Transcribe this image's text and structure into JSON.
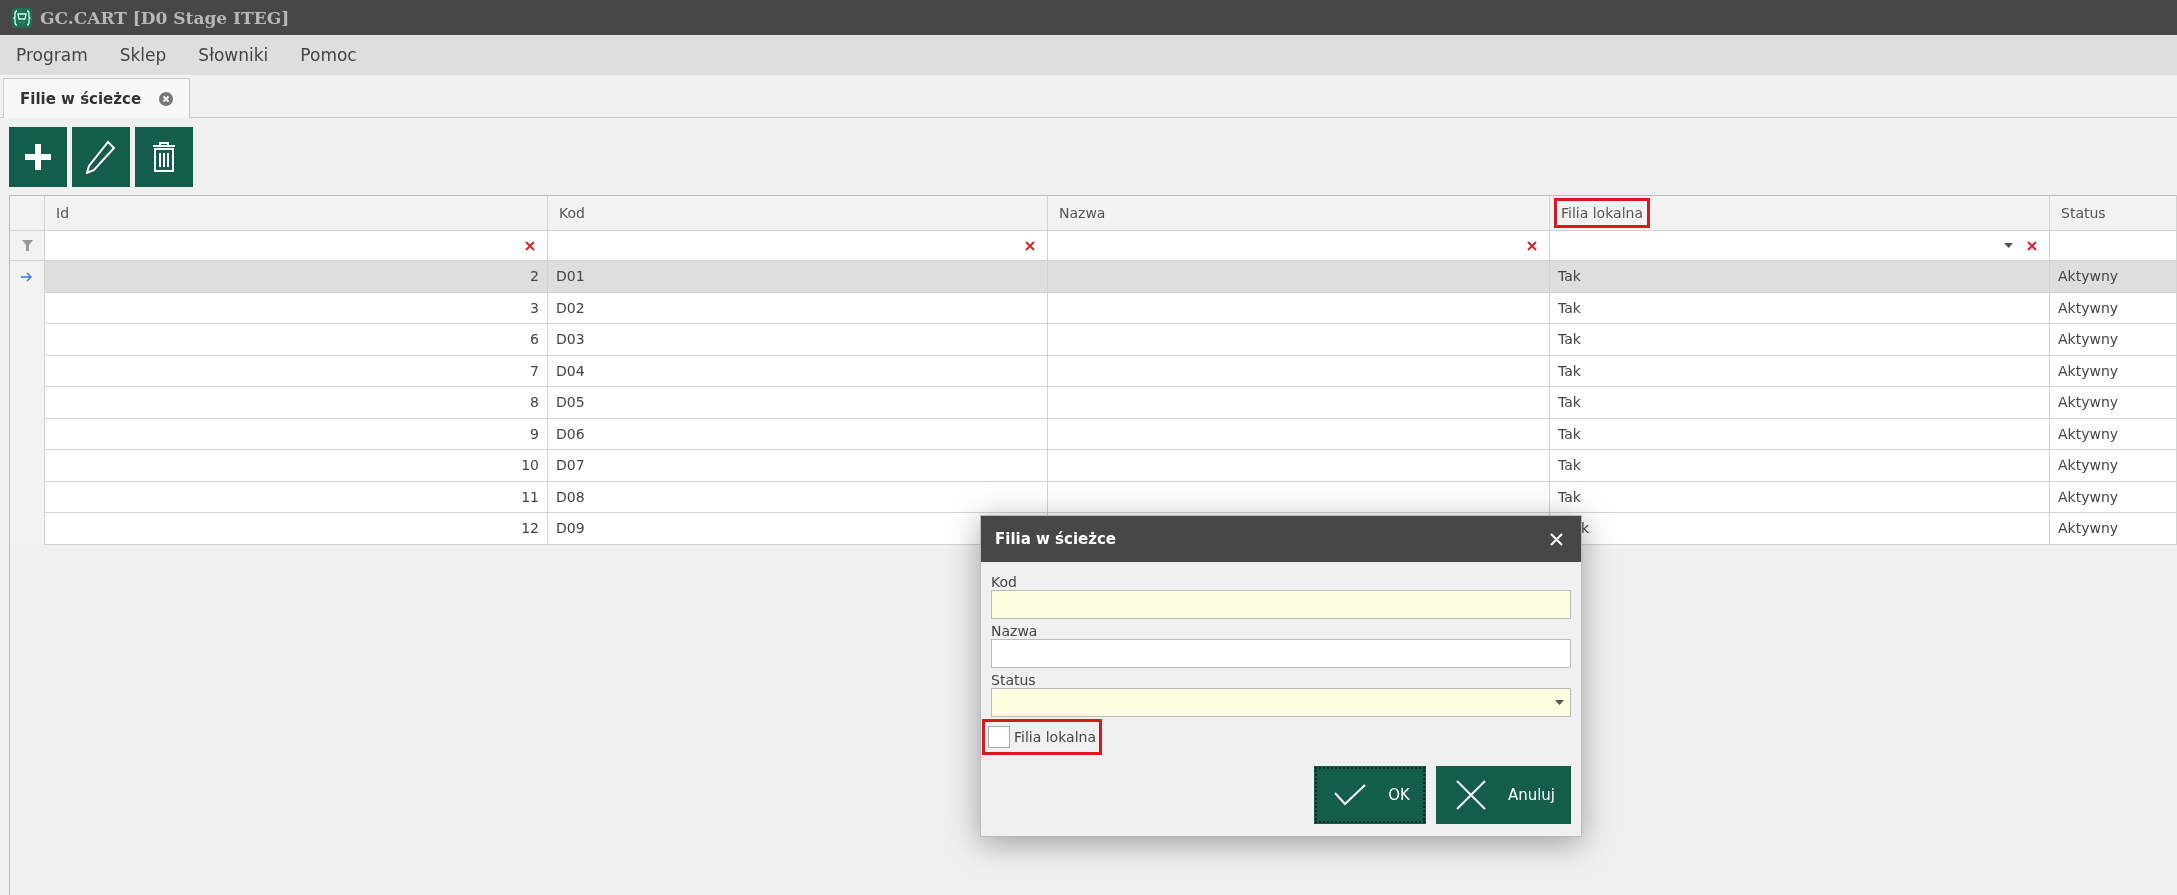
{
  "window": {
    "title": "GC.CART [D0 Stage ITEG]"
  },
  "menu": [
    "Program",
    "Sklep",
    "Słowniki",
    "Pomoc"
  ],
  "tabs": [
    {
      "label": "Filie w ścieżce",
      "selected": true
    }
  ],
  "toolbar": [
    {
      "kind": "add"
    },
    {
      "kind": "edit"
    },
    {
      "kind": "delete"
    }
  ],
  "grid": {
    "columns": [
      {
        "label": "Id",
        "highlighted": false,
        "filter_clear": true,
        "filter_dropdown": false
      },
      {
        "label": "Kod",
        "highlighted": false,
        "filter_clear": true,
        "filter_dropdown": false
      },
      {
        "label": "Nazwa",
        "highlighted": false,
        "filter_clear": true,
        "filter_dropdown": false
      },
      {
        "label": "Filia lokalna",
        "highlighted": true,
        "filter_clear": true,
        "filter_dropdown": true
      },
      {
        "label": "Status",
        "highlighted": false,
        "filter_clear": false,
        "filter_dropdown": false
      }
    ],
    "rows": [
      {
        "selected": true,
        "id": "2",
        "kod": "D01",
        "filia": "Tak",
        "status": "Aktywny"
      },
      {
        "selected": false,
        "id": "3",
        "kod": "D02",
        "filia": "Tak",
        "status": "Aktywny"
      },
      {
        "selected": false,
        "id": "6",
        "kod": "D03",
        "filia": "Tak",
        "status": "Aktywny"
      },
      {
        "selected": false,
        "id": "7",
        "kod": "D04",
        "filia": "Tak",
        "status": "Aktywny"
      },
      {
        "selected": false,
        "id": "8",
        "kod": "D05",
        "filia": "Tak",
        "status": "Aktywny"
      },
      {
        "selected": false,
        "id": "9",
        "kod": "D06",
        "filia": "Tak",
        "status": "Aktywny"
      },
      {
        "selected": false,
        "id": "10",
        "kod": "D07",
        "filia": "Tak",
        "status": "Aktywny"
      },
      {
        "selected": false,
        "id": "11",
        "kod": "D08",
        "filia": "Tak",
        "status": "Aktywny"
      },
      {
        "selected": false,
        "id": "12",
        "kod": "D09",
        "filia": "k",
        "status": "Aktywny",
        "covered": true
      }
    ]
  },
  "dialog": {
    "title": "Filia w ścieżce",
    "fields": [
      {
        "label": "Kod",
        "kind": "text",
        "required": true
      },
      {
        "label": "Nazwa",
        "kind": "text",
        "required": false
      },
      {
        "label": "Status",
        "kind": "dropdown",
        "required": true
      }
    ],
    "checkbox": {
      "label": "Filia lokalna",
      "checked": false,
      "highlighted": true
    },
    "buttons": [
      {
        "label": "OK",
        "kind": "ok",
        "focused": true
      },
      {
        "label": "Anuluj",
        "kind": "cancel",
        "focused": false
      }
    ]
  }
}
